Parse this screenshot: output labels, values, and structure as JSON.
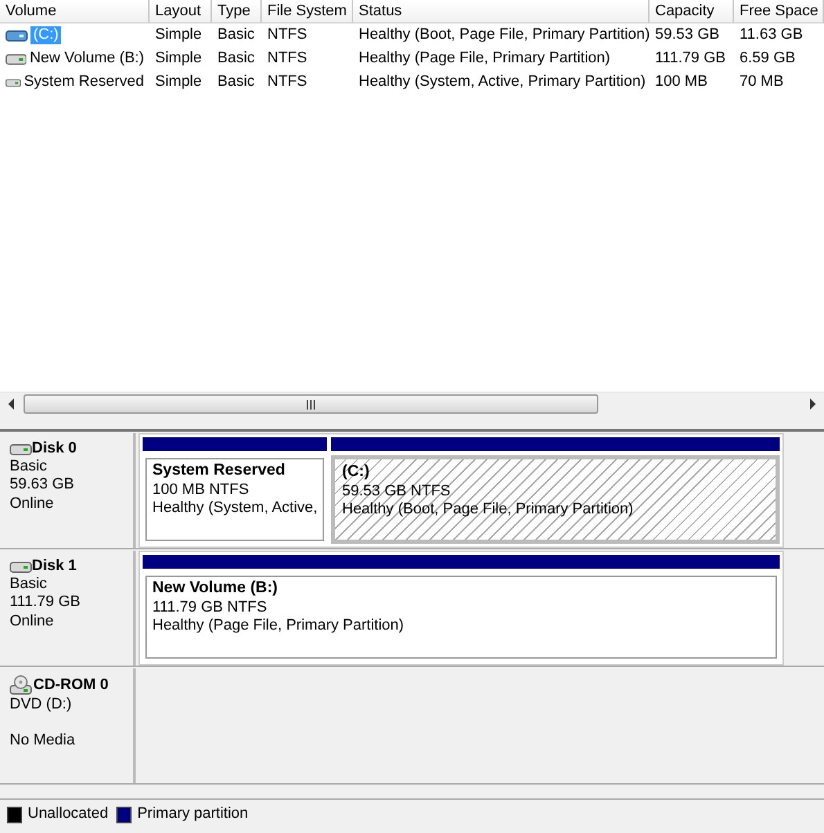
{
  "table": {
    "columns": [
      "Volume",
      "Layout",
      "Type",
      "File System",
      "Status",
      "Capacity",
      "Free Space"
    ],
    "rows": [
      {
        "cells": [
          "(C:)",
          "Simple",
          "Basic",
          "NTFS",
          "Healthy (Boot, Page File, Primary Partition)",
          "59.53 GB",
          "11.63 GB"
        ],
        "selected": true
      },
      {
        "cells": [
          "New Volume (B:)",
          "Simple",
          "Basic",
          "NTFS",
          "Healthy (Page File, Primary Partition)",
          "111.79 GB",
          "6.59 GB"
        ],
        "selected": false
      },
      {
        "cells": [
          "System Reserved",
          "Simple",
          "Basic",
          "NTFS",
          "Healthy (System, Active, Primary Partition)",
          "100 MB",
          "70 MB"
        ],
        "selected": false
      }
    ]
  },
  "disks": [
    {
      "kind": "disk",
      "name": "Disk 0",
      "lines": [
        "Basic",
        "59.63 GB",
        "Online"
      ],
      "partitions": [
        {
          "name": "System Reserved",
          "size": "100 MB NTFS",
          "status": "Healthy (System, Active,",
          "selected": false,
          "color": "#000080"
        },
        {
          "name": "(C:)",
          "size": "59.53 GB NTFS",
          "status": "Healthy (Boot, Page File, Primary Partition)",
          "selected": true,
          "color": "#000080"
        }
      ]
    },
    {
      "kind": "disk",
      "name": "Disk 1",
      "lines": [
        "Basic",
        "111.79 GB",
        "Online"
      ],
      "partitions": [
        {
          "name": "New Volume  (B:)",
          "size": "111.79 GB NTFS",
          "status": "Healthy (Page File, Primary Partition)",
          "selected": false,
          "color": "#000080"
        }
      ]
    },
    {
      "kind": "cdrom",
      "name": "CD-ROM 0",
      "lines": [
        "DVD (D:)",
        "No Media"
      ]
    }
  ],
  "legend": [
    {
      "label": "Unallocated",
      "color": "#000000"
    },
    {
      "label": "Primary partition",
      "color": "#000080"
    }
  ]
}
